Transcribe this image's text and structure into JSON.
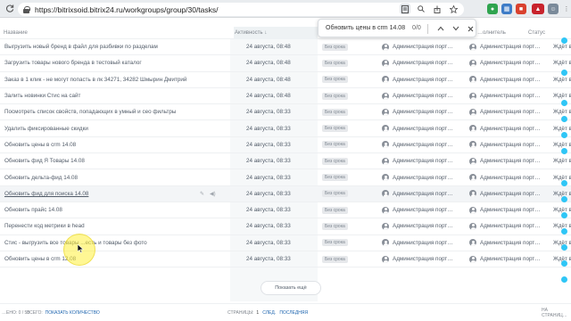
{
  "browser": {
    "url": "https://bitrixsoid.bitrix24.ru/workgroups/group/30/tasks/",
    "back_icon": "arrow-left",
    "forward_icon": "arrow-right",
    "reload_icon": "reload"
  },
  "find": {
    "query": "Обновить цены в crm 14.08",
    "count": "0/0"
  },
  "table": {
    "headers": {
      "name": "Название",
      "activity": "Активность",
      "executor": "…олнитель",
      "status": "Статус"
    },
    "rows": [
      {
        "name": "Выгрузить новый бренд в файл для разбивки по разделам",
        "date": "24 августа, 08:48",
        "badge": "Без срока",
        "creator": "Администрация порт…",
        "executor": "Администрация порт…",
        "status": "Ждёт в"
      },
      {
        "name": "Загрузить товары нового бренда в тестовый каталог",
        "date": "24 августа, 08:48",
        "badge": "Без срока",
        "creator": "Администрация порт…",
        "executor": "Администрация порт…",
        "status": "Ждёт в"
      },
      {
        "name": "Заказ в 1 клик - не могут попасть в лк 34271, 34282 Шмырин Дмитрий",
        "date": "24 августа, 08:48",
        "badge": "Без срока",
        "creator": "Администрация порт…",
        "executor": "Администрация порт…",
        "status": "Ждёт в"
      },
      {
        "name": "Залить новинки Стис на сайт",
        "date": "24 августа, 08:48",
        "badge": "Без срока",
        "creator": "Администрация порт…",
        "executor": "Администрация порт…",
        "status": "Ждёт в"
      },
      {
        "name": "Посмотреть список свойств, попадающих в умный и сео фильтры",
        "date": "24 августа, 08:33",
        "badge": "Без срока",
        "creator": "Администрация порт…",
        "executor": "Администрация порт…",
        "status": "Ждёт в"
      },
      {
        "name": "Удалить фиксированные скидки",
        "date": "24 августа, 08:33",
        "badge": "Без срока",
        "creator": "Администрация порт…",
        "executor": "Администрация порт…",
        "status": "Ждёт в"
      },
      {
        "name": "Обновить цены в crm 14.08",
        "date": "24 августа, 08:33",
        "badge": "Без срока",
        "creator": "Администрация порт…",
        "executor": "Администрация порт…",
        "status": "Ждёт в"
      },
      {
        "name": "Обновить фид Я Товары 14.08",
        "date": "24 августа, 08:33",
        "badge": "Без срока",
        "creator": "Администрация порт…",
        "executor": "Администрация порт…",
        "status": "Ждёт в"
      },
      {
        "name": "Обновить дельта-фид 14.08",
        "date": "24 августа, 08:33",
        "badge": "Без срока",
        "creator": "Администрация порт…",
        "executor": "Администрация порт…",
        "status": "Ждёт в"
      },
      {
        "name": "Обновить фид для поиска 14.08",
        "date": "24 августа, 08:33",
        "badge": "Без срока",
        "creator": "Администрация порт…",
        "executor": "Администрация порт…",
        "status": "Ждёт в"
      },
      {
        "name": "Обновить прайс 14.08",
        "date": "24 августа, 08:33",
        "badge": "Без срока",
        "creator": "Администрация порт…",
        "executor": "Администрация порт…",
        "status": "Ждёт в"
      },
      {
        "name": "Перенести код метрики в head",
        "date": "24 августа, 08:33",
        "badge": "Без срока",
        "creator": "Администрация порт…",
        "executor": "Администрация порт…",
        "status": "Ждёт в"
      },
      {
        "name": "Стис - выгрузить все товары ...есть и товары без фото",
        "date": "24 августа, 08:33",
        "badge": "Без срока",
        "creator": "Администрация порт…",
        "executor": "Администрация порт…",
        "status": "Ждёт в"
      },
      {
        "name": "Обновить цены в crm 12.08",
        "date": "24 августа, 08:33",
        "badge": "Без срока",
        "creator": "Администрация порт…",
        "executor": "Администрация порт…",
        "status": "Ждёт в"
      }
    ]
  },
  "show_more": "Показать ещё",
  "footer": {
    "selected": "…ЕНО: 0 / 50",
    "total_label": "ВСЕГО:",
    "total_link": "ПОКАЗАТЬ КОЛИЧЕСТВО",
    "pages_label": "СТРАНИЦЫ:",
    "page": "1",
    "next": "СЛЕД.",
    "last": "ПОСЛЕДНЯЯ",
    "per_page": "НА СТРАНИЦ…"
  },
  "colors": {
    "accent": "#2fc6f6",
    "link": "#2067b0"
  }
}
